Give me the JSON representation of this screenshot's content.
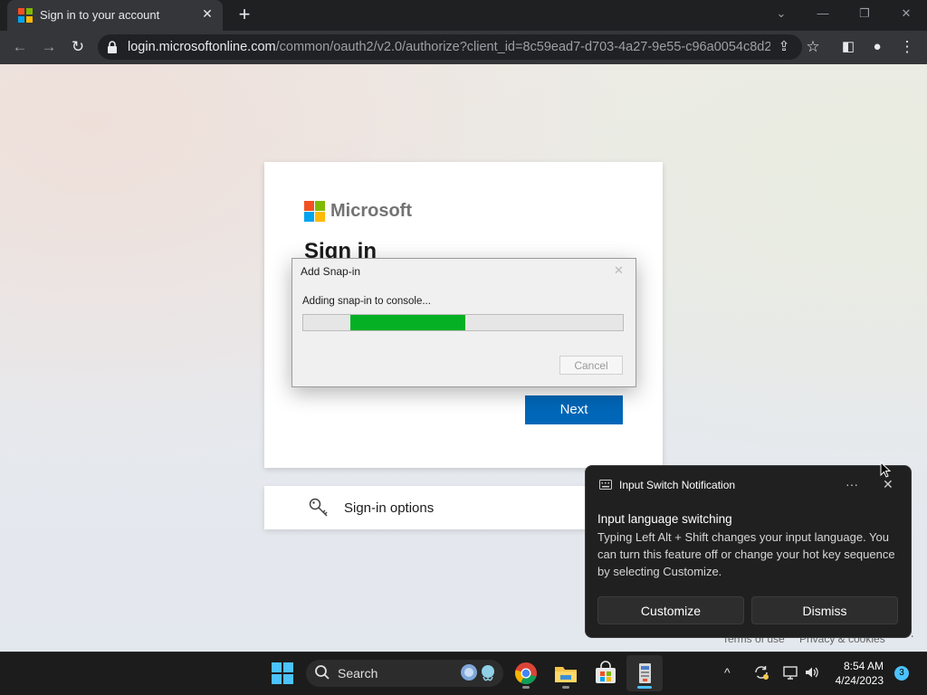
{
  "browser": {
    "tab_title": "Sign in to your account",
    "tab_close": "✕",
    "new_tab": "+",
    "url_host": "login.microsoftonline.com",
    "url_path": "/common/oauth2/v2.0/authorize?client_id=8c59ead7-d703-4a27-9e55-c96a0054c8d2...",
    "controls": {
      "dropdown": "⌄",
      "minimize": "—",
      "restore": "❐",
      "close": "✕"
    },
    "nav": {
      "back": "←",
      "forward": "→",
      "reload": "↻"
    },
    "toolbar_icons": {
      "share": "⇪",
      "bookmark": "☆",
      "sidepanel": "◧",
      "profile": "●",
      "menu": "⋮"
    }
  },
  "page": {
    "brand": "Microsoft",
    "heading": "Sign in",
    "next_label": "Next",
    "signin_options": "Sign-in options",
    "footer_terms": "Terms of use",
    "footer_privacy": "Privacy & cookies",
    "footer_more": "···"
  },
  "dialog": {
    "title": "Add Snap-in",
    "close": "✕",
    "message": "Adding snap-in to console...",
    "progress_fraction": 0.36,
    "cancel_label": "Cancel"
  },
  "notification": {
    "app": "Input Switch Notification",
    "more": "···",
    "close": "✕",
    "title": "Input language switching",
    "body": "Typing Left Alt + Shift changes your input language. You can turn this feature off or change your hot key sequence by selecting Customize.",
    "customize_label": "Customize",
    "dismiss_label": "Dismiss"
  },
  "taskbar": {
    "search_label": "Search",
    "tray_up": "^",
    "time": "8:54 AM",
    "date": "4/24/2023",
    "badge_count": "3"
  },
  "colors": {
    "ms_red": "#f25022",
    "ms_green": "#7fba00",
    "ms_blue": "#00a4ef",
    "ms_yellow": "#ffb900",
    "next_button": "#0067b8",
    "progress": "#06b025",
    "windows_accent": "#4cc2ff"
  }
}
